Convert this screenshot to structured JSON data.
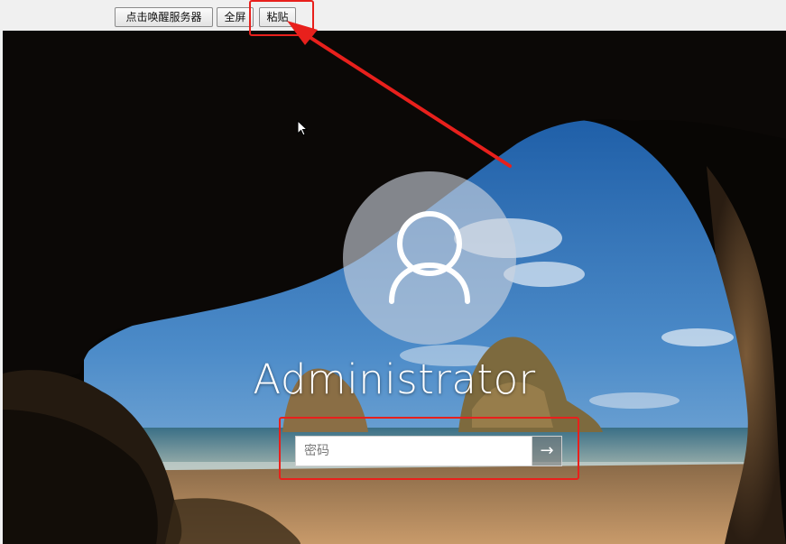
{
  "toolbar": {
    "wake_label": "点击唤醒服务器",
    "fullscreen_label": "全屏",
    "paste_label": "粘贴"
  },
  "login": {
    "username": "Administrator",
    "password_placeholder": "密码",
    "submit_icon": "arrow-right-icon",
    "avatar_icon": "user-silhouette-icon"
  },
  "colors": {
    "annotation": "#e8201c",
    "toolbar_bg": "#f0f0f0",
    "sky": "#3f7fc4"
  }
}
